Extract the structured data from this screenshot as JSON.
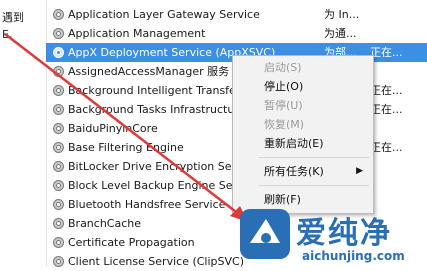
{
  "left_pane": {
    "line1": "遇到",
    "line2": "E,"
  },
  "services": [
    {
      "name": "Application Layer Gateway Service",
      "desc": "为 In...",
      "status": ""
    },
    {
      "name": "Application Management",
      "desc": "为通...",
      "status": ""
    },
    {
      "name": "AppX Deployment Service (AppXSVC)",
      "desc": "为部...",
      "status": "正在...",
      "selected": true
    },
    {
      "name": "AssignedAccessManager 服务",
      "desc": "",
      "status": ""
    },
    {
      "name": "Background Intelligent Transfer",
      "desc": "",
      "status": "正在..."
    },
    {
      "name": "Background Tasks Infrastructur",
      "desc": "",
      "status": "正在..."
    },
    {
      "name": "BaiduPinyinCore",
      "desc": "",
      "status": ""
    },
    {
      "name": "Base Filtering Engine",
      "desc": "",
      "status": "正在..."
    },
    {
      "name": "BitLocker Drive Encryption Serv",
      "desc": "",
      "status": ""
    },
    {
      "name": "Block Level Backup Engine Serv",
      "desc": "",
      "status": ""
    },
    {
      "name": "Bluetooth Handsfree Service",
      "desc": "",
      "status": ""
    },
    {
      "name": "BranchCache",
      "desc": "",
      "status": ""
    },
    {
      "name": "Certificate Propagation",
      "desc": "",
      "status": ""
    },
    {
      "name": "Client License Service (ClipSVC)",
      "desc": "",
      "status": ""
    }
  ],
  "context_menu": {
    "start": "启动(S)",
    "stop": "停止(O)",
    "pause": "暂停(U)",
    "resume": "恢复(M)",
    "restart": "重新启动(E)",
    "all_tasks": "所有任务(K)",
    "refresh": "刷新(F)"
  },
  "watermark": {
    "brand": "爱纯净",
    "url": "aichunjing.com"
  },
  "colors": {
    "selection": "#3d8fe5",
    "arrow": "#e0393a",
    "logo": "#2a6fb6"
  }
}
